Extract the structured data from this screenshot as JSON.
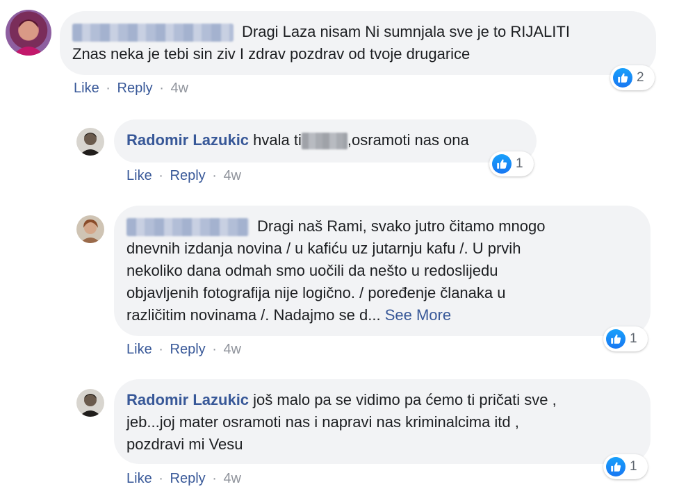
{
  "comments": [
    {
      "author": "",
      "text": "Dragi Laza nisam Ni sumnjala sve je to RIJALITI Znas neka je tebi sin ziv I zdrav pozdrav od tvoje drugarice",
      "line1": "Dragi Laza nisam Ni sumnjala sve je to RIJALITI",
      "line2": "Znas neka je tebi sin ziv I zdrav pozdrav od tvoje drugarice",
      "like_label": "Like",
      "reply_label": "Reply",
      "time": "4w",
      "reactions": "2"
    },
    {
      "author": "Radomir Lazukic",
      "text_before": "hvala ti",
      "text_after": ",osramoti nas ona",
      "like_label": "Like",
      "reply_label": "Reply",
      "time": "4w",
      "reactions": "1"
    },
    {
      "author": "",
      "line1": "Dragi naš Rami, svako jutro čitamo mnogo",
      "line2": "dnevnih izdanja novina / u kafiću uz jutarnju kafu /. U prvih",
      "line3": "nekoliko dana odmah smo uočili da nešto u redoslijedu",
      "line4": "objavljenih fotografija nije logično. / poređenje članaka u",
      "line5": "različitim novinama /. Nadajmo se d...",
      "see_more": "See More",
      "like_label": "Like",
      "reply_label": "Reply",
      "time": "4w",
      "reactions": "1"
    },
    {
      "author": "Radomir Lazukic",
      "line1": "još malo pa se vidimo pa ćemo ti pričati sve ,",
      "line2": "jeb...joj mater osramoti nas i napravi nas kriminalcima itd ,",
      "line3": "pozdravi mi Vesu",
      "like_label": "Like",
      "reply_label": "Reply",
      "time": "4w",
      "reactions": "1"
    }
  ],
  "separator": "·",
  "colors": {
    "link": "#385898",
    "bubble": "#f2f3f5",
    "like_blue": "#1877f2"
  }
}
